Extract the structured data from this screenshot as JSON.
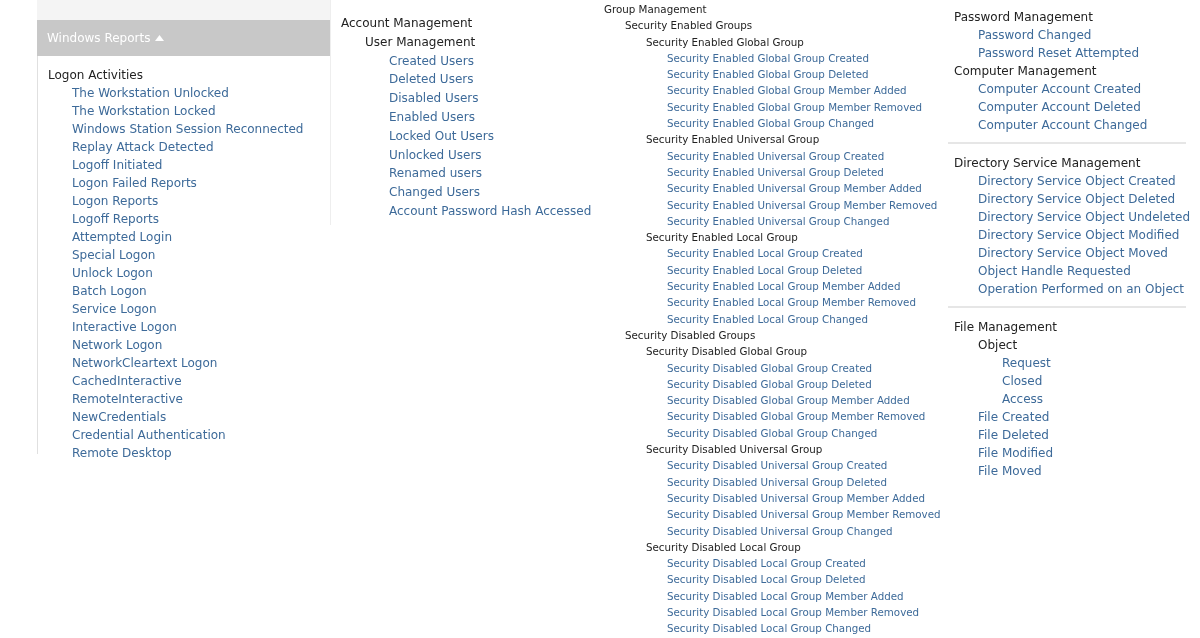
{
  "panel": {
    "title": "Windows Reports",
    "expanded": true
  },
  "columns": [
    {
      "sections": [
        {
          "tree": [
            {
              "label": "Logon Activities",
              "children": [
                {
                  "label": "The Workstation Unlocked"
                },
                {
                  "label": "The Workstation Locked"
                },
                {
                  "label": "Windows Station Session Reconnected"
                },
                {
                  "label": "Replay Attack Detected"
                },
                {
                  "label": "Logoff Initiated"
                },
                {
                  "label": "Logon Failed Reports"
                },
                {
                  "label": "Logon Reports"
                },
                {
                  "label": "Logoff Reports"
                },
                {
                  "label": "Attempted Login"
                },
                {
                  "label": "Special Logon"
                },
                {
                  "label": "Unlock Logon"
                },
                {
                  "label": "Batch Logon"
                },
                {
                  "label": "Service Logon"
                },
                {
                  "label": "Interactive Logon"
                },
                {
                  "label": "Network Logon"
                },
                {
                  "label": "NetworkCleartext Logon"
                },
                {
                  "label": "CachedInteractive"
                },
                {
                  "label": "RemoteInteractive"
                },
                {
                  "label": "NewCredentials"
                },
                {
                  "label": "Credential Authentication"
                },
                {
                  "label": "Remote Desktop"
                }
              ]
            }
          ]
        }
      ]
    },
    {
      "sections": [
        {
          "tree": [
            {
              "label": "Account Management",
              "children": [
                {
                  "label": "User Management",
                  "children": [
                    {
                      "label": "Created Users"
                    },
                    {
                      "label": "Deleted Users"
                    },
                    {
                      "label": "Disabled Users"
                    },
                    {
                      "label": "Enabled Users"
                    },
                    {
                      "label": "Locked Out Users"
                    },
                    {
                      "label": "Unlocked Users"
                    },
                    {
                      "label": "Renamed users"
                    },
                    {
                      "label": "Changed Users"
                    },
                    {
                      "label": "Account Password Hash Accessed"
                    }
                  ]
                }
              ]
            }
          ]
        }
      ]
    },
    {
      "sections": [
        {
          "tree": [
            {
              "label": "Group Management",
              "children": [
                {
                  "label": "Security Enabled Groups",
                  "children": [
                    {
                      "label": "Security Enabled Global Group",
                      "children": [
                        {
                          "label": "Security Enabled Global Group Created"
                        },
                        {
                          "label": "Security Enabled Global Group Deleted"
                        },
                        {
                          "label": "Security Enabled Global Group Member Added"
                        },
                        {
                          "label": "Security Enabled Global Group Member Removed"
                        },
                        {
                          "label": "Security Enabled Global Group Changed"
                        }
                      ]
                    },
                    {
                      "label": "Security Enabled Universal Group",
                      "children": [
                        {
                          "label": "Security Enabled Universal Group Created"
                        },
                        {
                          "label": "Security Enabled Universal Group Deleted"
                        },
                        {
                          "label": "Security Enabled Universal Group Member Added"
                        },
                        {
                          "label": "Security Enabled Universal Group Member Removed"
                        },
                        {
                          "label": "Security Enabled Universal Group Changed"
                        }
                      ]
                    },
                    {
                      "label": "Security Enabled Local Group",
                      "children": [
                        {
                          "label": "Security Enabled Local Group Created"
                        },
                        {
                          "label": "Security Enabled Local Group Deleted"
                        },
                        {
                          "label": "Security Enabled Local Group Member Added"
                        },
                        {
                          "label": "Security Enabled Local Group Member Removed"
                        },
                        {
                          "label": "Security Enabled Local Group Changed"
                        }
                      ]
                    }
                  ]
                },
                {
                  "label": "Security Disabled Groups",
                  "children": [
                    {
                      "label": "Security Disabled Global Group",
                      "children": [
                        {
                          "label": "Security Disabled Global Group Created"
                        },
                        {
                          "label": "Security Disabled Global Group Deleted"
                        },
                        {
                          "label": "Security Disabled Global Group Member Added"
                        },
                        {
                          "label": "Security Disabled Global Group Member Removed"
                        },
                        {
                          "label": "Security Disabled Global Group Changed"
                        }
                      ]
                    },
                    {
                      "label": "Security Disabled Universal Group",
                      "children": [
                        {
                          "label": "Security Disabled Universal Group Created"
                        },
                        {
                          "label": "Security Disabled Universal Group Deleted"
                        },
                        {
                          "label": "Security Disabled Universal Group Member Added"
                        },
                        {
                          "label": "Security Disabled Universal Group Member Removed"
                        },
                        {
                          "label": "Security Disabled Universal Group Changed"
                        }
                      ]
                    },
                    {
                      "label": "Security Disabled Local Group",
                      "children": [
                        {
                          "label": "Security Disabled Local Group Created"
                        },
                        {
                          "label": "Security Disabled Local Group Deleted"
                        },
                        {
                          "label": "Security Disabled Local Group Member Added"
                        },
                        {
                          "label": "Security Disabled Local Group Member Removed"
                        },
                        {
                          "label": "Security Disabled Local Group Changed"
                        }
                      ]
                    }
                  ]
                }
              ]
            }
          ]
        }
      ]
    },
    {
      "sections": [
        {
          "tree": [
            {
              "label": "Password Management",
              "children": [
                {
                  "label": "Password Changed"
                },
                {
                  "label": "Password Reset Attempted"
                }
              ]
            },
            {
              "label": "Computer Management",
              "children": [
                {
                  "label": "Computer Account Created"
                },
                {
                  "label": "Computer Account Deleted"
                },
                {
                  "label": "Computer Account Changed"
                }
              ]
            }
          ]
        },
        {
          "tree": [
            {
              "label": "Directory Service Management",
              "children": [
                {
                  "label": "Directory Service Object Created"
                },
                {
                  "label": "Directory Service Object Deleted"
                },
                {
                  "label": "Directory Service Object Undeleted"
                },
                {
                  "label": "Directory Service Object Modified"
                },
                {
                  "label": "Directory Service Object Moved"
                },
                {
                  "label": "Object Handle Requested"
                },
                {
                  "label": "Operation Performed on an Object"
                }
              ]
            }
          ]
        },
        {
          "tree": [
            {
              "label": "File Management",
              "children": [
                {
                  "label": "Object",
                  "children": [
                    {
                      "label": "Request"
                    },
                    {
                      "label": "Closed"
                    },
                    {
                      "label": "Access"
                    }
                  ]
                },
                {
                  "label": "File Created"
                },
                {
                  "label": "File Deleted"
                },
                {
                  "label": "File Modified"
                },
                {
                  "label": "File Moved"
                }
              ]
            }
          ]
        }
      ]
    }
  ]
}
